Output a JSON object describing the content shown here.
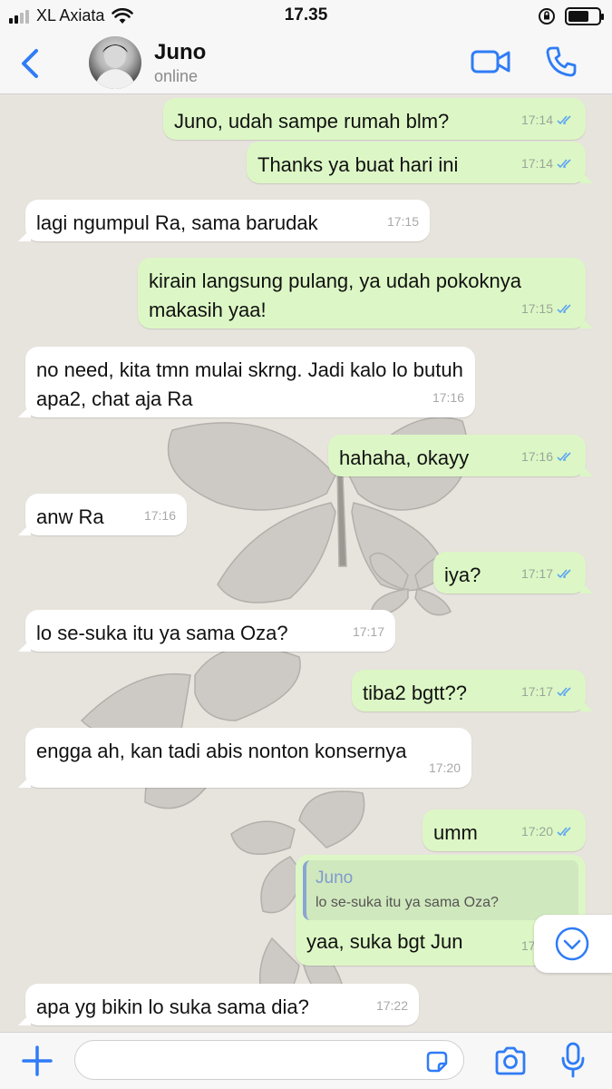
{
  "status_bar": {
    "carrier": "XL Axiata",
    "time": "17.35"
  },
  "header": {
    "contact_name": "Juno",
    "contact_status": "online"
  },
  "messages": [
    {
      "dir": "out",
      "text": "Juno, udah sampe rumah blm?",
      "time": "17:14",
      "read": true
    },
    {
      "dir": "out",
      "text": "Thanks ya buat hari ini",
      "time": "17:14",
      "read": true
    },
    {
      "dir": "in",
      "text": "lagi ngumpul Ra, sama barudak",
      "time": "17:15"
    },
    {
      "dir": "out",
      "text": "kirain langsung pulang, ya udah pokoknya makasih yaa!",
      "time": "17:15",
      "read": true
    },
    {
      "dir": "in",
      "text": "no need, kita tmn mulai skrng. Jadi kalo lo butuh apa2, chat aja Ra",
      "time": "17:16"
    },
    {
      "dir": "out",
      "text": "hahaha, okayy",
      "time": "17:16",
      "read": true
    },
    {
      "dir": "in",
      "text": "anw Ra",
      "time": "17:16"
    },
    {
      "dir": "out",
      "text": "iya?",
      "time": "17:17",
      "read": true
    },
    {
      "dir": "in",
      "text": "lo se-suka itu ya sama Oza?",
      "time": "17:17"
    },
    {
      "dir": "out",
      "text": "tiba2 bgtt??",
      "time": "17:17",
      "read": true
    },
    {
      "dir": "in",
      "text": "engga ah, kan tadi abis nonton konsernya",
      "time": "17:20"
    },
    {
      "dir": "out",
      "text": "umm",
      "time": "17:20",
      "read": true
    },
    {
      "dir": "out",
      "text": "yaa, suka bgt Jun",
      "time": "17:21",
      "read": true,
      "reply_to": {
        "name": "Juno",
        "text": "lo se-suka itu ya sama Oza?"
      }
    },
    {
      "dir": "in",
      "text": "apa yg bikin lo suka sama dia?",
      "time": "17:22"
    }
  ],
  "input": {
    "placeholder": ""
  },
  "colors": {
    "accent": "#2f7cf6",
    "outgoing": "#dcf7c5",
    "incoming": "#ffffff",
    "read_tick": "#5ea5f2"
  },
  "icons": [
    "back-chevron-icon",
    "video-call-icon",
    "phone-icon",
    "chevron-down-icon",
    "plus-icon",
    "sticker-icon",
    "camera-icon",
    "microphone-icon"
  ]
}
